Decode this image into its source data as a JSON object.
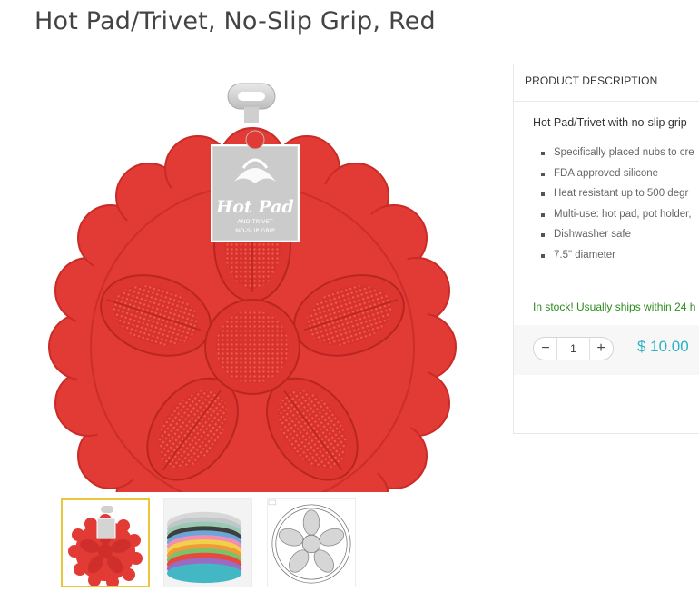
{
  "product": {
    "title": "Hot Pad/Trivet, No-Slip Grip, Red",
    "main_image_alt": "Red silicone flower-shaped hot pad",
    "tag": {
      "brand": "Hot Pad",
      "line1": "AND TRIVET",
      "line2": "NO-SLIP GRIP"
    },
    "colors": {
      "product_red": "#e23a34",
      "thumb_selected_border": "#e9c63a"
    }
  },
  "thumbnails": [
    {
      "label": "Red hot pad"
    },
    {
      "label": "Stacked colors"
    },
    {
      "label": "Line drawing"
    }
  ],
  "description": {
    "header": "PRODUCT DESCRIPTION",
    "subtitle": "Hot Pad/Trivet with no-slip grip",
    "features": [
      "Specifically placed nubs to cre",
      "FDA approved silicone",
      "Heat resistant up to 500 degr",
      "Multi-use: hot pad, pot holder,",
      "Dishwasher safe",
      "7.5\" diameter"
    ],
    "stock": "In stock! Usually ships within 24 h"
  },
  "purchase": {
    "minus": "−",
    "plus": "+",
    "quantity": "1",
    "price": "$ 10.00",
    "colors": {
      "price": "#2ab3c1",
      "stock": "#2e8b1f"
    }
  }
}
